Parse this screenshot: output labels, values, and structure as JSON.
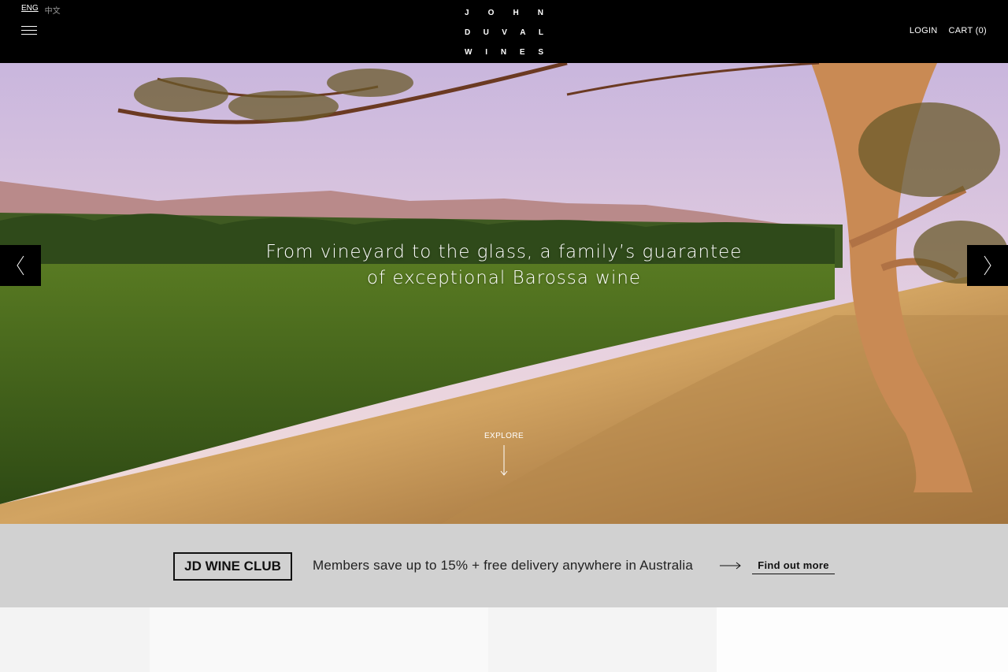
{
  "header": {
    "lang_active": "ENG",
    "lang_alt": "中文",
    "logo_lines": [
      [
        "J",
        "O",
        "H",
        "N"
      ],
      [
        "D",
        "U",
        "V",
        "A",
        "L"
      ],
      [
        "W",
        "I",
        "N",
        "E",
        "S"
      ]
    ],
    "login": "LOGIN",
    "cart": "CART (0)"
  },
  "hero": {
    "tagline_line1": "From vineyard to the glass, a family’s guarantee",
    "tagline_line2": "of exceptional Barossa wine",
    "explore": "EXPLORE"
  },
  "club": {
    "badge": "JD WINE CLUB",
    "text": "Members save up to 15% + free delivery anywhere in Australia",
    "link": "Find out more"
  },
  "icons": [
    "menu-icon",
    "chevron-left-icon",
    "chevron-right-icon",
    "arrow-down-icon",
    "arrow-right-icon"
  ],
  "colors": {
    "header_bg": "#000000",
    "club_bg": "#d1d1d1",
    "text_dark": "#111111"
  }
}
